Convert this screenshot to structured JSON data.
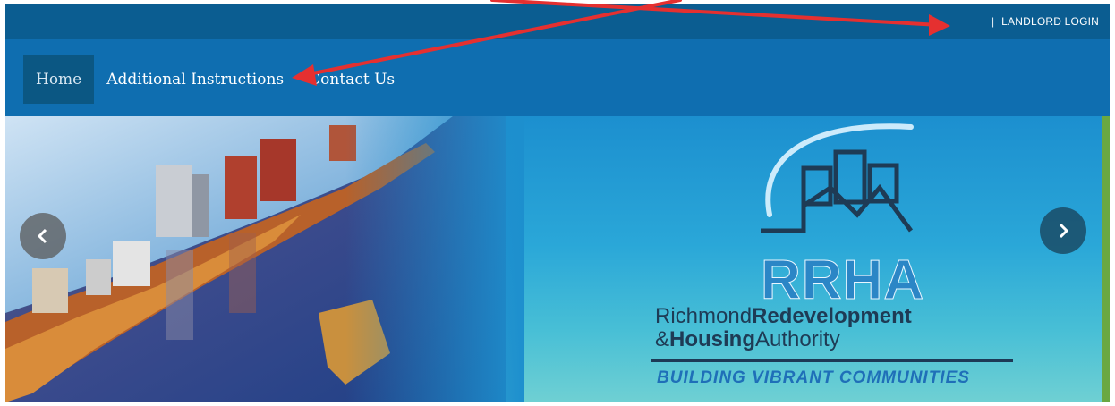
{
  "header": {
    "separator": "|",
    "login_label": "LANDLORD LOGIN"
  },
  "nav": {
    "items": [
      {
        "label": "Home",
        "active": true
      },
      {
        "label": "Additional Instructions",
        "active": false
      },
      {
        "label": "Contact Us",
        "active": false
      }
    ]
  },
  "hero": {
    "logo": {
      "acronym": "RRHA",
      "name_line1_regular": "Richmond",
      "name_line1_bold": "Redevelopment",
      "name_line2_regular": "&",
      "name_line2_bold": "Housing",
      "name_line2_tail": "Authority",
      "tagline": "BUILDING VIBRANT COMMUNITIES"
    },
    "prev_icon": "chevron-left-icon",
    "next_icon": "chevron-right-icon"
  },
  "colors": {
    "topbar": "#0b5d91",
    "navbar": "#0f6eb0",
    "nav_active": "#0b5783",
    "annotation": "#e53030"
  }
}
